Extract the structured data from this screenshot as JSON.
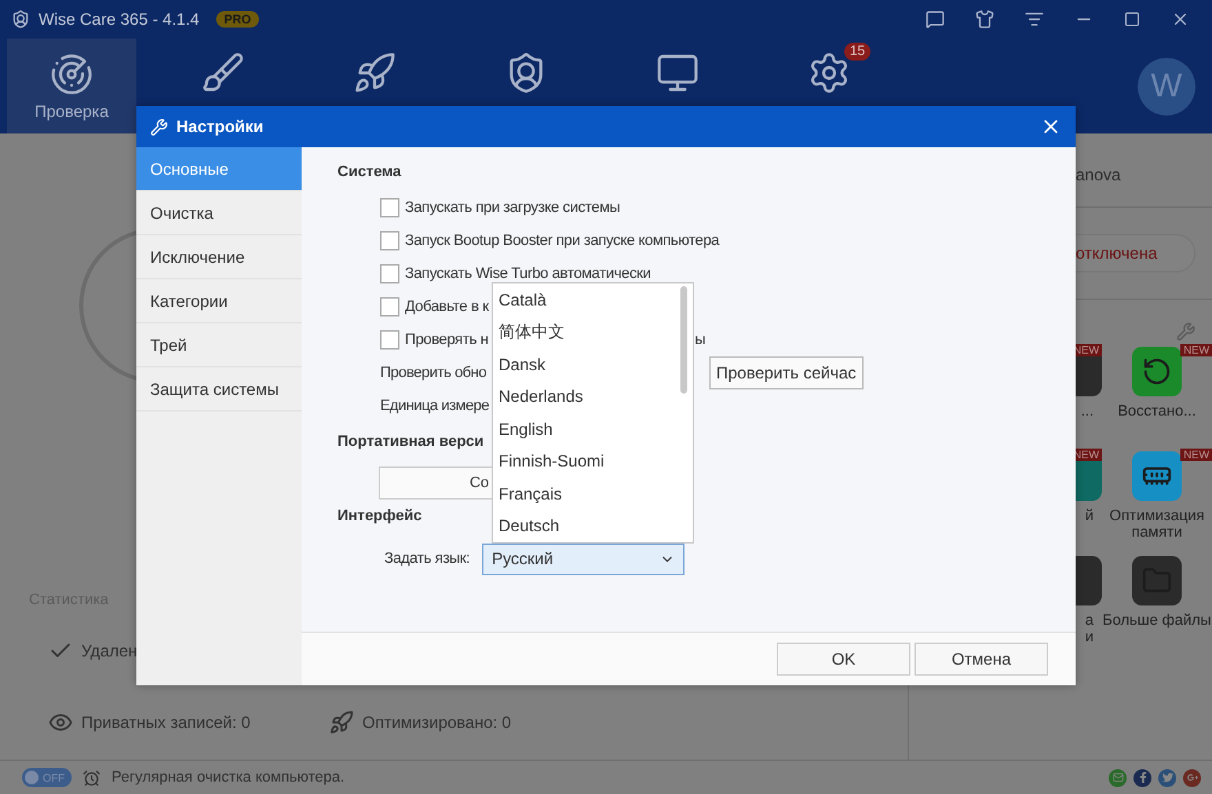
{
  "app": {
    "title": "Wise Care 365 - 4.1.4",
    "edition": "PRO"
  },
  "nav": [
    {
      "kind": "scan",
      "label": "Проверка",
      "selected": true
    },
    {
      "kind": "clean",
      "selected": false
    },
    {
      "kind": "boost",
      "selected": false
    },
    {
      "kind": "privacy",
      "selected": false
    },
    {
      "kind": "monitor",
      "selected": false
    },
    {
      "kind": "tools",
      "selected": false,
      "badge": "15"
    }
  ],
  "avatar": "W",
  "right_panel": {
    "user": "anova",
    "status_button": "отключена",
    "tools": [
      {
        "kind": "dark",
        "label": "...",
        "new": "NEW"
      },
      {
        "kind": "restore",
        "label": "Восстано...",
        "new": "NEW"
      },
      {
        "kind": "teal",
        "label": "й",
        "new": "NEW"
      },
      {
        "kind": "memory",
        "label": "Оптимизация памяти",
        "new": "NEW"
      },
      {
        "kind": "dark",
        "label": "а и"
      },
      {
        "kind": "folder",
        "label": "Больше файлы"
      }
    ]
  },
  "stats": {
    "title": "Статистика",
    "items": [
      {
        "kind": "clean",
        "text": "Удален"
      },
      {
        "kind": "privacy",
        "text": "Приватных записей: 0"
      },
      {
        "kind": "boost",
        "text": "Оптимизировано: 0"
      }
    ]
  },
  "status_bar": {
    "schedule": {
      "on": false,
      "label": "OFF"
    },
    "text": "Регулярная очистка компьютера."
  },
  "dialog": {
    "title": "Настройки",
    "sidebar": [
      {
        "label": "Основные",
        "selected": true
      },
      {
        "label": "Очистка",
        "selected": false
      },
      {
        "label": "Исключение",
        "selected": false
      },
      {
        "label": "Категории",
        "selected": false
      },
      {
        "label": "Трей",
        "selected": false
      },
      {
        "label": "Защита системы",
        "selected": false
      }
    ],
    "system": {
      "title": "Система",
      "checkboxes": [
        {
          "label": "Запускать при загрузке системы",
          "checked": false
        },
        {
          "label": "Запуск Bootup Booster при запуске компьютера",
          "checked": false
        },
        {
          "label": "Запускать Wise Turbo автоматически",
          "checked": false
        },
        {
          "label": "Добавьте в к",
          "checked": false
        },
        {
          "label": "Проверять н",
          "tail": "ы",
          "checked": false
        }
      ],
      "update_label": "Проверить обно",
      "update_button": "Проверить сейчас",
      "unit_label": "Единица измере"
    },
    "portable": {
      "title": "Портативная верси",
      "button": "Со"
    },
    "interface": {
      "title": "Интерфейс",
      "language_label": "Задать язык:",
      "language": "Русский",
      "open": true,
      "options": [
        "Català",
        "简体中文",
        "Dansk",
        "Nederlands",
        "English",
        "Finnish-Suomi",
        "Français",
        "Deutsch"
      ]
    },
    "buttons": [
      "OK",
      "Отмена"
    ]
  }
}
